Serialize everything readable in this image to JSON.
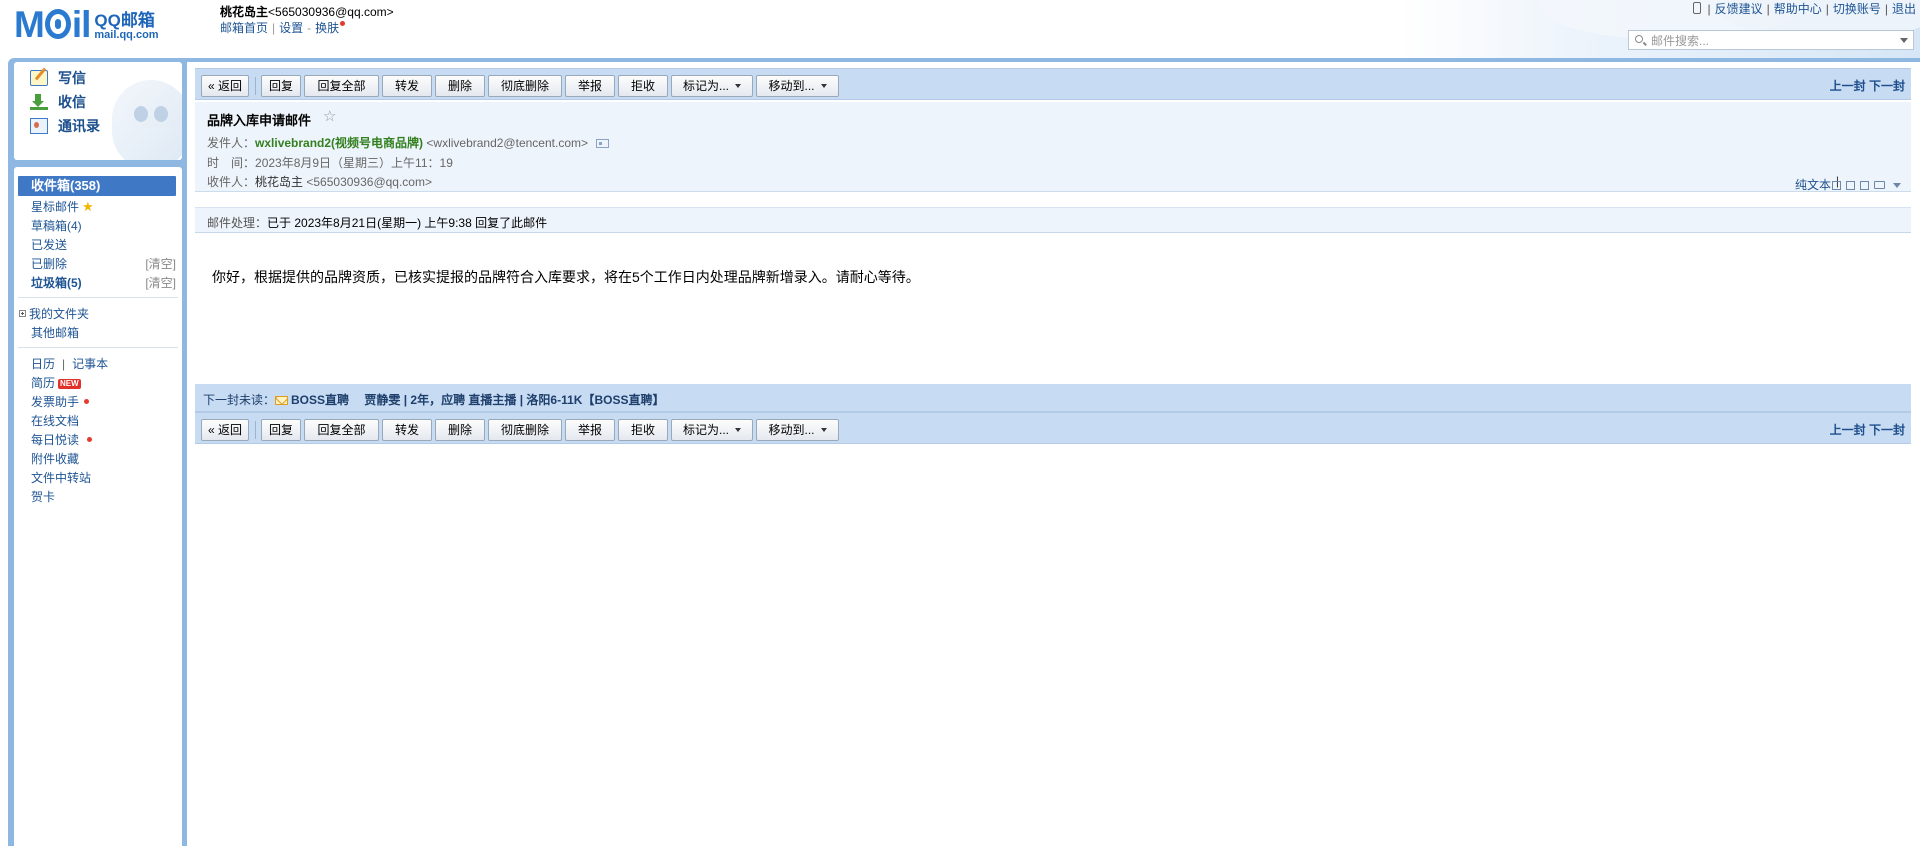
{
  "header": {
    "logo_text": "M",
    "logo_text_tail": "il",
    "logo_cn": "QQ邮箱",
    "logo_url": "mail.qq.com",
    "user_name": "桃花岛主",
    "user_email": "<565030936@qq.com>",
    "links": {
      "home": "邮箱首页",
      "settings": "设置",
      "skin": "换肤"
    },
    "top_links": {
      "feedback": "反馈建议",
      "help": "帮助中心",
      "switch": "切换账号",
      "logout": "退出"
    },
    "search_placeholder": "邮件搜索..."
  },
  "sidebar": {
    "write": "写信",
    "receive": "收信",
    "contacts": "通讯录",
    "folders": {
      "inbox": "收件箱(358)",
      "starred": "星标邮件",
      "drafts": "草稿箱(4)",
      "sent": "已发送",
      "deleted": "已删除",
      "deleted_action": "[清空]",
      "spam": "垃圾箱(5)",
      "spam_action": "[清空]",
      "my_folders": "我的文件夹",
      "other_mailbox": "其他邮箱"
    },
    "apps": {
      "calendar": "日历",
      "notes": "记事本",
      "resume": "简历",
      "new_badge": "NEW",
      "invoice": "发票助手",
      "docs": "在线文档",
      "daily_read": "每日悦读",
      "attachments": "附件收藏",
      "transfer": "文件中转站",
      "cards": "贺卡"
    }
  },
  "toolbar": {
    "back": "« 返回",
    "reply": "回复",
    "reply_all": "回复全部",
    "forward": "转发",
    "delete": "删除",
    "delete_permanent": "彻底删除",
    "report": "举报",
    "reject": "拒收",
    "mark_as": "标记为...",
    "move_to": "移动到...",
    "prev": "上一封",
    "next": "下一封"
  },
  "mail": {
    "subject": "品牌入库申请邮件",
    "star": "☆",
    "from_label": "发件人：",
    "from_name": "wxlivebrand2(视频号电商品牌)",
    "from_email": "<wxlivebrand2@tencent.com>",
    "time_label": "时　间：",
    "time_value": "2023年8月9日（星期三）上午11：19",
    "to_label": "收件人：",
    "to_name": "桃花岛主",
    "to_email": "<565030936@qq.com>",
    "plain_text": "纯文本",
    "process_label": "邮件处理：",
    "process_value": "已于 2023年8月21日(星期一) 上午9:38 回复了此邮件",
    "body": "你好，根据提供的品牌资质，已核实提报的品牌符合入库要求，将在5个工作日内处理品牌新增录入。请耐心等待。"
  },
  "next_unread": {
    "label": "下一封未读：",
    "sender": "BOSS直聘",
    "subject": "贾静雯 | 2年，应聘 直播主播 | 洛阳6-11K【BOSS直聘】"
  },
  "colors": {
    "frame_blue": "#8eb8e2",
    "toolbar_blue": "#c7dbf3",
    "inbox_selected": "#3f78c5",
    "sender_green": "#338020",
    "link_blue": "#1e5494"
  }
}
